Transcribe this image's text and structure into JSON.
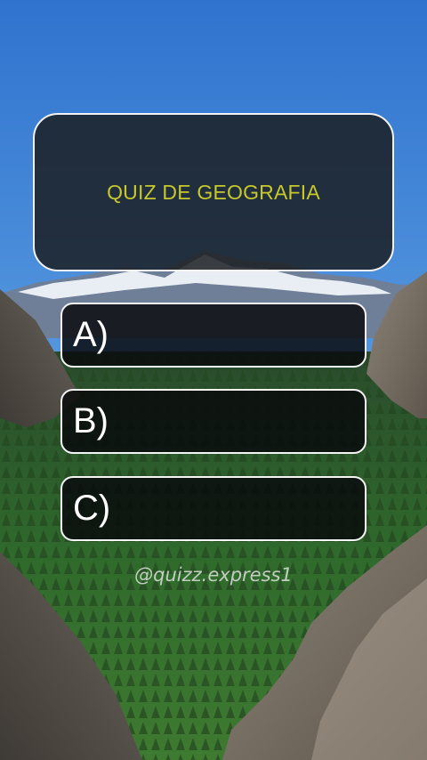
{
  "quiz": {
    "title": "QUIZ DE GEOGRAFIA",
    "title_color": "#c7c82a",
    "options": [
      {
        "label": "A)"
      },
      {
        "label": "B)"
      },
      {
        "label": "C)"
      }
    ]
  },
  "watermark": "@quizz.express1",
  "background": {
    "scene": "mountain-valley-forest",
    "sky_color": "#3f86d6",
    "forest_color": "#2f5a2a"
  }
}
